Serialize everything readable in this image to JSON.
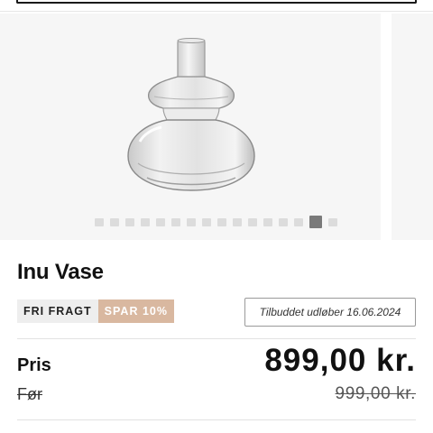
{
  "product": {
    "title": "Inu Vase",
    "badges": {
      "free_freight": "FRI FRAGT",
      "save": "SPAR 10%"
    },
    "offer_expiry": "Tilbuddet udløber 16.06.2024",
    "price": {
      "label": "Pris",
      "value": "899,00 kr."
    },
    "previous_price": {
      "label": "Før",
      "value": "999,00 kr."
    }
  },
  "gallery": {
    "image_icon": "glass-vase-image",
    "slide_count": 16,
    "active_index": 14
  },
  "colors": {
    "save_badge": "#d9b8a0",
    "freight_badge": "#eeeeee",
    "dot_active": "#7a7a7a",
    "dot_inactive": "#dcdcdc"
  }
}
